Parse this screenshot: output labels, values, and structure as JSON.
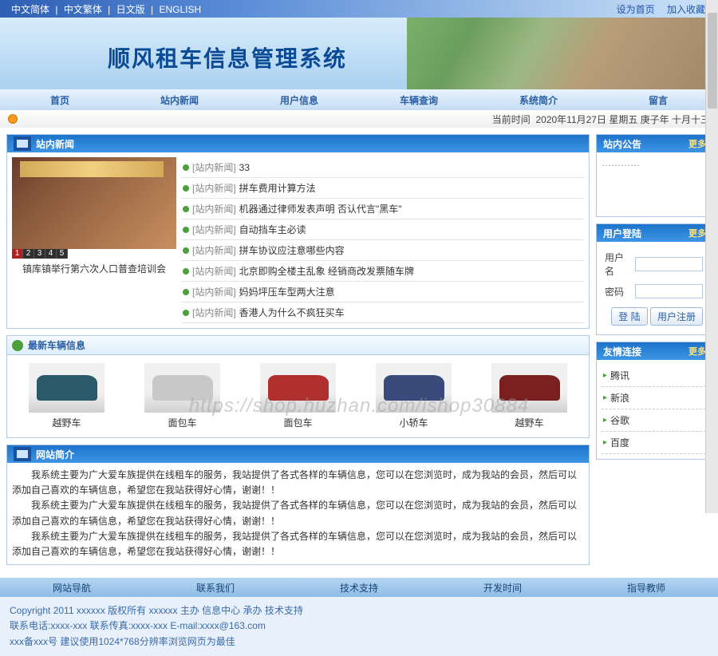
{
  "top": {
    "langs": [
      "中文简体",
      "中文繁体",
      "日文版",
      "ENGLISH"
    ],
    "set_home": "设为首页",
    "favorite": "加入收藏"
  },
  "banner": {
    "title": "顺风租车信息管理系统"
  },
  "nav": [
    "首页",
    "站内新闻",
    "用户信息",
    "车辆查询",
    "系统简介",
    "留言"
  ],
  "date": {
    "label": "当前时间",
    "value": "2020年11月27日 星期五 庚子年 十月十三"
  },
  "news": {
    "title": "站内新闻",
    "slider_caption": "镇库镇举行第六次人口普查培训会",
    "pager": [
      "1",
      "2",
      "3",
      "4",
      "5"
    ],
    "items": [
      {
        "cat": "[站内新闻]",
        "title": "33"
      },
      {
        "cat": "[站内新闻]",
        "title": "拼车费用计算方法"
      },
      {
        "cat": "[站内新闻]",
        "title": "机器通过律师发表声明 否认代言\"黑车\""
      },
      {
        "cat": "[站内新闻]",
        "title": "自动挡车主必读"
      },
      {
        "cat": "[站内新闻]",
        "title": "拼车协议应注意哪些内容"
      },
      {
        "cat": "[站内新闻]",
        "title": "北京即购全楼主乱象 经销商改发票随车牌"
      },
      {
        "cat": "[站内新闻]",
        "title": "妈妈坪压车型两大注意"
      },
      {
        "cat": "[站内新闻]",
        "title": "香港人为什么不疯狂买车"
      }
    ]
  },
  "cars": {
    "title": "最新车辆信息",
    "items": [
      {
        "name": "越野车",
        "color": "#2a5a6a"
      },
      {
        "name": "面包车",
        "color": "#c8c8c8"
      },
      {
        "name": "面包车",
        "color": "#b03030"
      },
      {
        "name": "小轿车",
        "color": "#3a4a7a"
      },
      {
        "name": "越野车",
        "color": "#7a2020"
      }
    ]
  },
  "intro": {
    "title": "网站简介",
    "p1": "我系统主要为广大爱车族提供在线租车的服务，我站提供了各式各样的车辆信息，您可以在您浏览时，成为我站的会员，然后可以添加自己喜欢的车辆信息，希望您在我站获得好心情，谢谢！！",
    "p2": "我系统主要为广大爱车族提供在线租车的服务，我站提供了各式各样的车辆信息，您可以在您浏览时，成为我站的会员，然后可以添加自己喜欢的车辆信息，希望您在我站获得好心情，谢谢！！",
    "p3": "我系统主要为广大爱车族提供在线租车的服务，我站提供了各式各样的车辆信息，您可以在您浏览时，成为我站的会员，然后可以添加自己喜欢的车辆信息，希望您在我站获得好心情，谢谢！！"
  },
  "announce": {
    "title": "站内公告",
    "more": "更多",
    "body": "…………"
  },
  "login": {
    "title": "用户登陆",
    "more": "更多",
    "user_label": "用户名",
    "pwd_label": "密码",
    "login_btn": "登 陆",
    "reg_btn": "用户注册"
  },
  "links": {
    "title": "友情连接",
    "more": "更多",
    "items": [
      "腾讯",
      "新浪",
      "谷歌",
      "百度"
    ]
  },
  "footer_nav": [
    "网站导航",
    "联系我们",
    "技术支持",
    "开发时间",
    "指导教师"
  ],
  "copy": {
    "l1": "Copyright 2011 xxxxxx 版权所有 xxxxxx 主办 信息中心 承办 技术支持",
    "l2": "联系电话:xxxx-xxx 联系传真:xxxx-xxx E-mail:xxxx@163.com",
    "l3": "xxx备xxx号   建议使用1024*768分辨率浏览网页为最佳"
  },
  "watermark": "https://shop.huzhan.com/ishop30884"
}
